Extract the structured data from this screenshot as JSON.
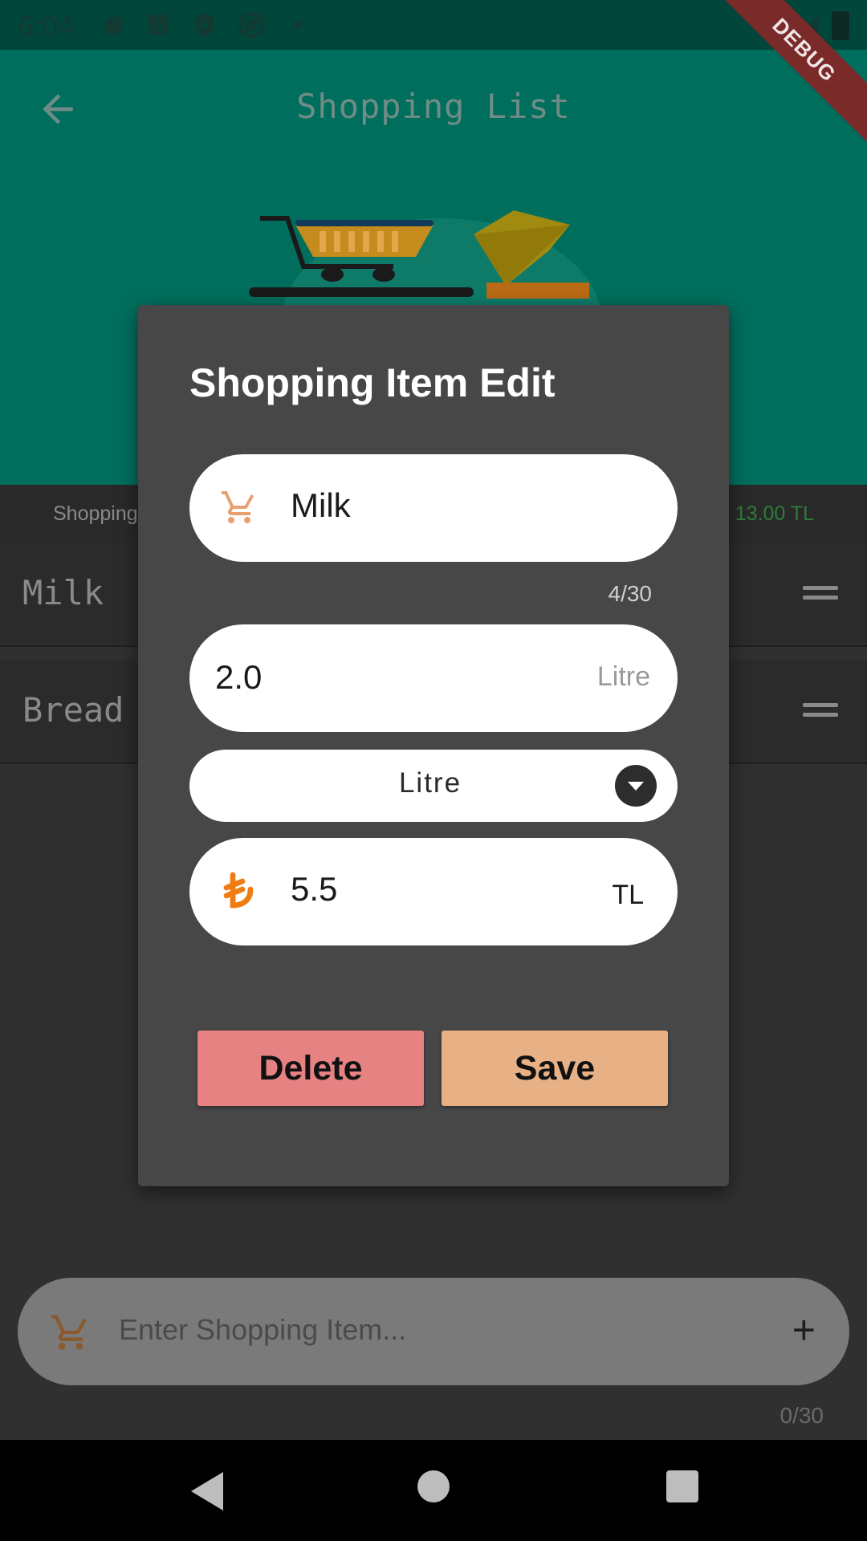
{
  "status_bar": {
    "time": "6:04",
    "icons": [
      "settings-icon",
      "keyboard-a-icon",
      "shield-play-icon",
      "at-circle-icon",
      "dot-icon",
      "signal-icon",
      "battery-icon"
    ]
  },
  "debug_banner": "DEBUG",
  "app_bar": {
    "title": "Shopping List",
    "back_icon": "arrow-left-icon"
  },
  "summary": {
    "label": "Shopping",
    "total": "13.00 TL"
  },
  "list": {
    "items": [
      {
        "name": "Milk"
      },
      {
        "name": "Bread"
      }
    ]
  },
  "dialog": {
    "title": "Shopping Item Edit",
    "name_field": {
      "value": "Milk",
      "counter": "4/30",
      "icon": "cart-icon"
    },
    "quantity_field": {
      "value": "2.0",
      "suffix": "Litre"
    },
    "unit_dropdown": {
      "selected": "Litre"
    },
    "price_field": {
      "value": "5.5",
      "suffix": "TL",
      "icon": "lira-icon"
    },
    "delete_label": "Delete",
    "save_label": "Save"
  },
  "bottom_input": {
    "placeholder": "Enter Shopping Item...",
    "counter": "0/30",
    "add_icon": "plus-icon"
  },
  "colors": {
    "header": "#006e5c",
    "status_bar": "#00463a",
    "dialog_bg": "#474747",
    "delete": "#e68282",
    "save": "#e8b185",
    "accent_orange": "#f07d14",
    "total_green": "#2f7c3a"
  }
}
